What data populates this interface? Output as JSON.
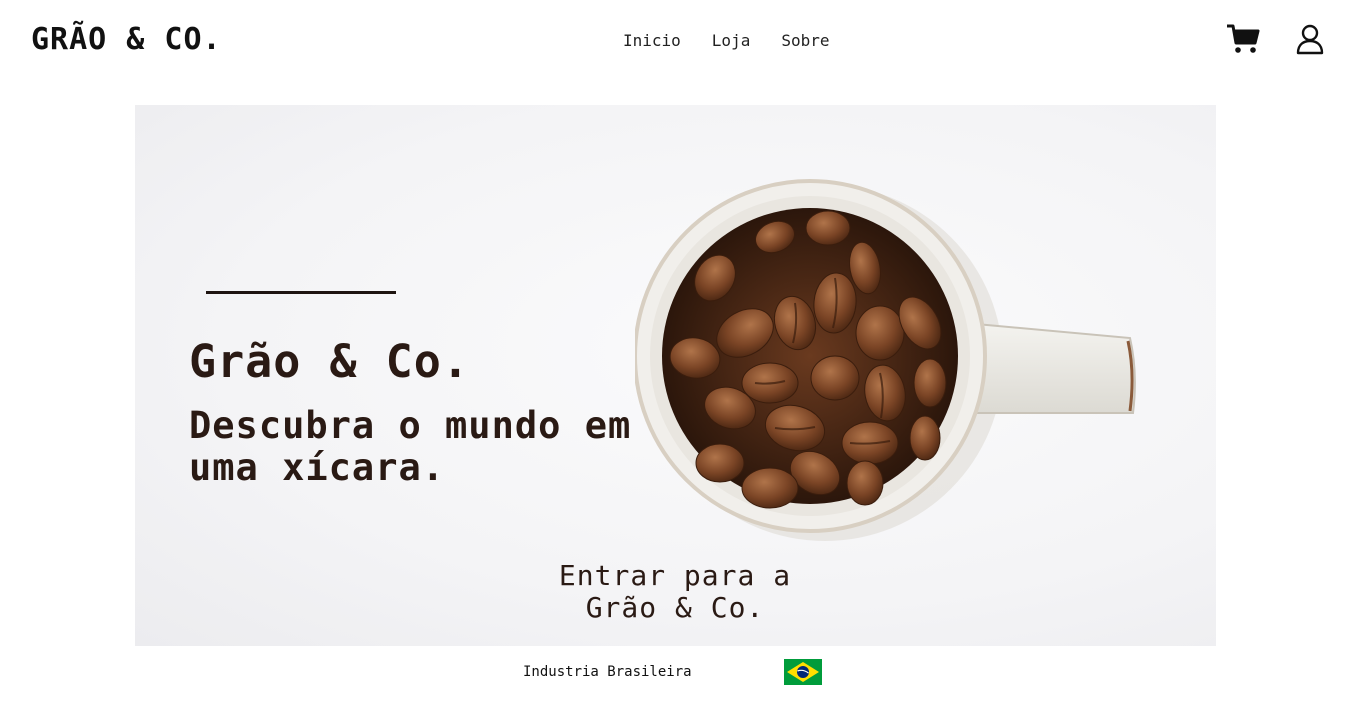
{
  "header": {
    "logo": "GRÃO & CO.",
    "nav": [
      "Inicio",
      "Loja",
      "Sobre"
    ],
    "icons": [
      "cart-icon",
      "user-icon"
    ]
  },
  "hero": {
    "title": "Grão & Co.",
    "subtitle": "Descubra o mundo em uma xícara.",
    "cta": "Entrar para a Grão & Co."
  },
  "footer": {
    "text": "Industria Brasileira",
    "flag_icon": "brazil-flag-icon"
  },
  "colors": {
    "text_dark": "#2a1a14",
    "flag_green": "#009c3b",
    "flag_yellow": "#ffdf00",
    "flag_blue": "#002776"
  }
}
